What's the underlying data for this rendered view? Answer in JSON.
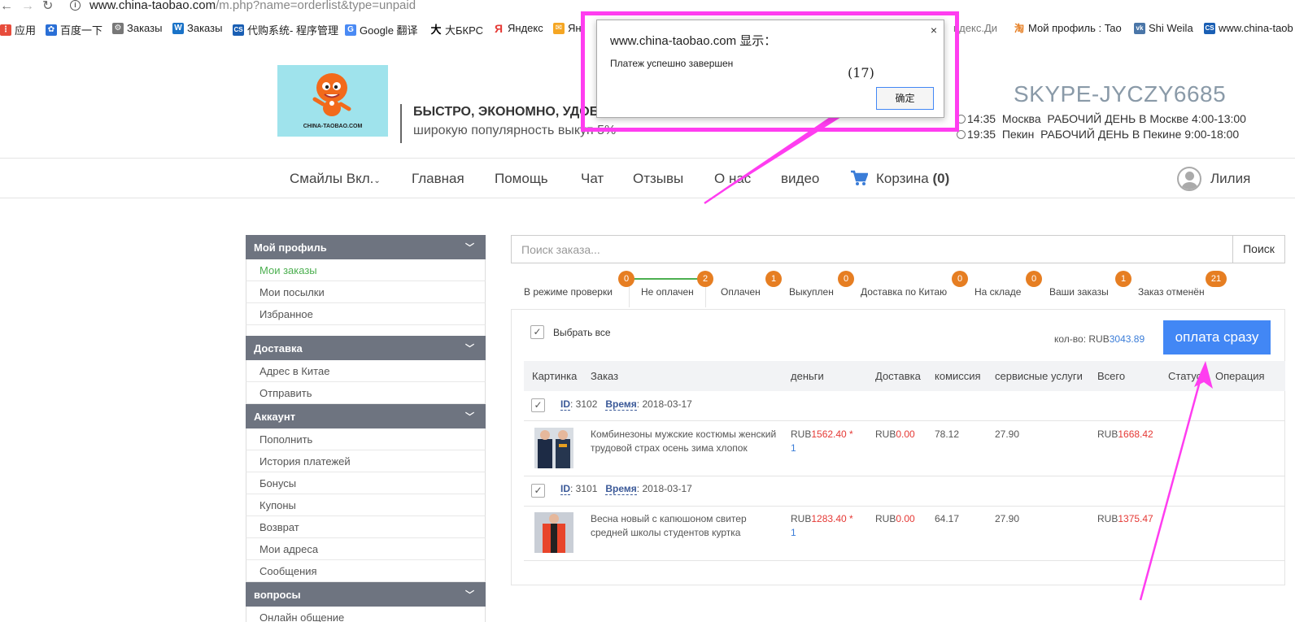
{
  "browser": {
    "url_prefix": "www.china-taobao.com",
    "url_path": "/m.php?name=orderlist&type=unpaid",
    "bookmarks": [
      {
        "label": "应用"
      },
      {
        "label": "百度一下"
      },
      {
        "label": "Заказы"
      },
      {
        "label": "Заказы"
      },
      {
        "label": "代购系统- 程序管理"
      },
      {
        "label": "Google 翻译"
      },
      {
        "label": "大БКРС"
      },
      {
        "label": "Яндекс"
      },
      {
        "label": "Ян"
      },
      {
        "label": "ндекс.Ди"
      },
      {
        "label": "Мой профиль : Tao"
      },
      {
        "label": "Shi Weila"
      },
      {
        "label": "www.china-taob"
      }
    ]
  },
  "header": {
    "logo_text": "CHINA-TAOBAO.COM",
    "slogan_line1": "БЫСТРО, ЭКОНОМНО, УДОБ",
    "slogan_line2": "широкую популярность выкуп 5%",
    "skype": "SKYPE-JYCZY6685",
    "clock1_time": "14:35",
    "clock1_city": "Москва",
    "clock1_hours": "РАБОЧИЙ ДЕНЬ В Москве 4:00-13:00",
    "clock2_time": "19:35",
    "clock2_city": "Пекин",
    "clock2_hours": "РАБОЧИЙ ДЕНЬ В Пекине 9:00-18:00"
  },
  "nav": {
    "smileys": "Смайлы Вкл.",
    "home": "Главная",
    "help": "Помощь",
    "chat": "Чат",
    "reviews": "Отзывы",
    "about": "О нас",
    "video": "видео",
    "cart_label": "Корзина",
    "cart_count": "(0)",
    "user_name": "Лилия"
  },
  "sidebar": {
    "profile_head": "Мой профиль",
    "my_orders": "Мои заказы",
    "my_parcels": "Мои посылки",
    "favorites": "Избранное",
    "delivery_head": "Доставка",
    "china_address": "Адрес в Китае",
    "send": "Отправить",
    "account_head": "Аккаунт",
    "top_up": "Пополнить",
    "payment_history": "История платежей",
    "bonuses": "Бонусы",
    "coupons": "Купоны",
    "refund": "Возврат",
    "my_addresses": "Мои адреса",
    "messages": "Сообщения",
    "questions_head": "вопросы",
    "online_chat": "Онлайн общение"
  },
  "search": {
    "placeholder": "Поиск заказа...",
    "button": "Поиск"
  },
  "tabs": [
    {
      "label": "В режиме проверки",
      "count": "0"
    },
    {
      "label": "Не оплачен",
      "count": "2"
    },
    {
      "label": "Оплачен",
      "count": "1"
    },
    {
      "label": "Выкуплен",
      "count": "0"
    },
    {
      "label": "Доставка по Китаю",
      "count": "0"
    },
    {
      "label": "На складе",
      "count": "0"
    },
    {
      "label": "Ваши заказы",
      "count": "1"
    },
    {
      "label": "Заказ отменён",
      "count": "21"
    }
  ],
  "orders_panel": {
    "select_all": "Выбрать все",
    "total_label": "кол-во:",
    "total_currency": "RUB",
    "total_value": "3043.89",
    "pay_button": "оплата сразу",
    "columns": {
      "picture": "Картинка",
      "order": "Заказ",
      "money": "деньги",
      "delivery": "Доставка",
      "commission": "комиссия",
      "service": "сервисные услуги",
      "total": "Всего",
      "status": "Статус",
      "operation": "Операция"
    },
    "orders": [
      {
        "id_label": "ID",
        "id": "3102",
        "time_label": "Время",
        "date": "2018-03-17",
        "description": "Комбинезоны мужские костюмы женский трудовой страх осень зима хлопок",
        "price_currency": "RUB",
        "price": "1562.40 *",
        "quantity": "1",
        "delivery_currency": "RUB",
        "delivery": "0.00",
        "commission": "78.12",
        "service": "27.90",
        "total_currency": "RUB",
        "total": "1668.42"
      },
      {
        "id_label": "ID",
        "id": "3101",
        "time_label": "Время",
        "date": "2018-03-17",
        "description": "Весна новый с капюшоном свитер средней школы студентов куртка",
        "price_currency": "RUB",
        "price": "1283.40 *",
        "quantity": "1",
        "delivery_currency": "RUB",
        "delivery": "0.00",
        "commission": "64.17",
        "service": "27.90",
        "total_currency": "RUB",
        "total": "1375.47"
      }
    ]
  },
  "dialog": {
    "title": "www.china-taobao.com 显示：",
    "message": "Платеж успешно завершен",
    "counter": "(17)",
    "ok_button": "确定",
    "close": "×"
  },
  "colors": {
    "accent_blue": "#4287f5",
    "badge_orange": "#e67e22",
    "annotation_magenta": "#ff3df0",
    "sidebar_header": "#6e7480",
    "active_green": "#4caf50",
    "price_red": "#e53935"
  }
}
